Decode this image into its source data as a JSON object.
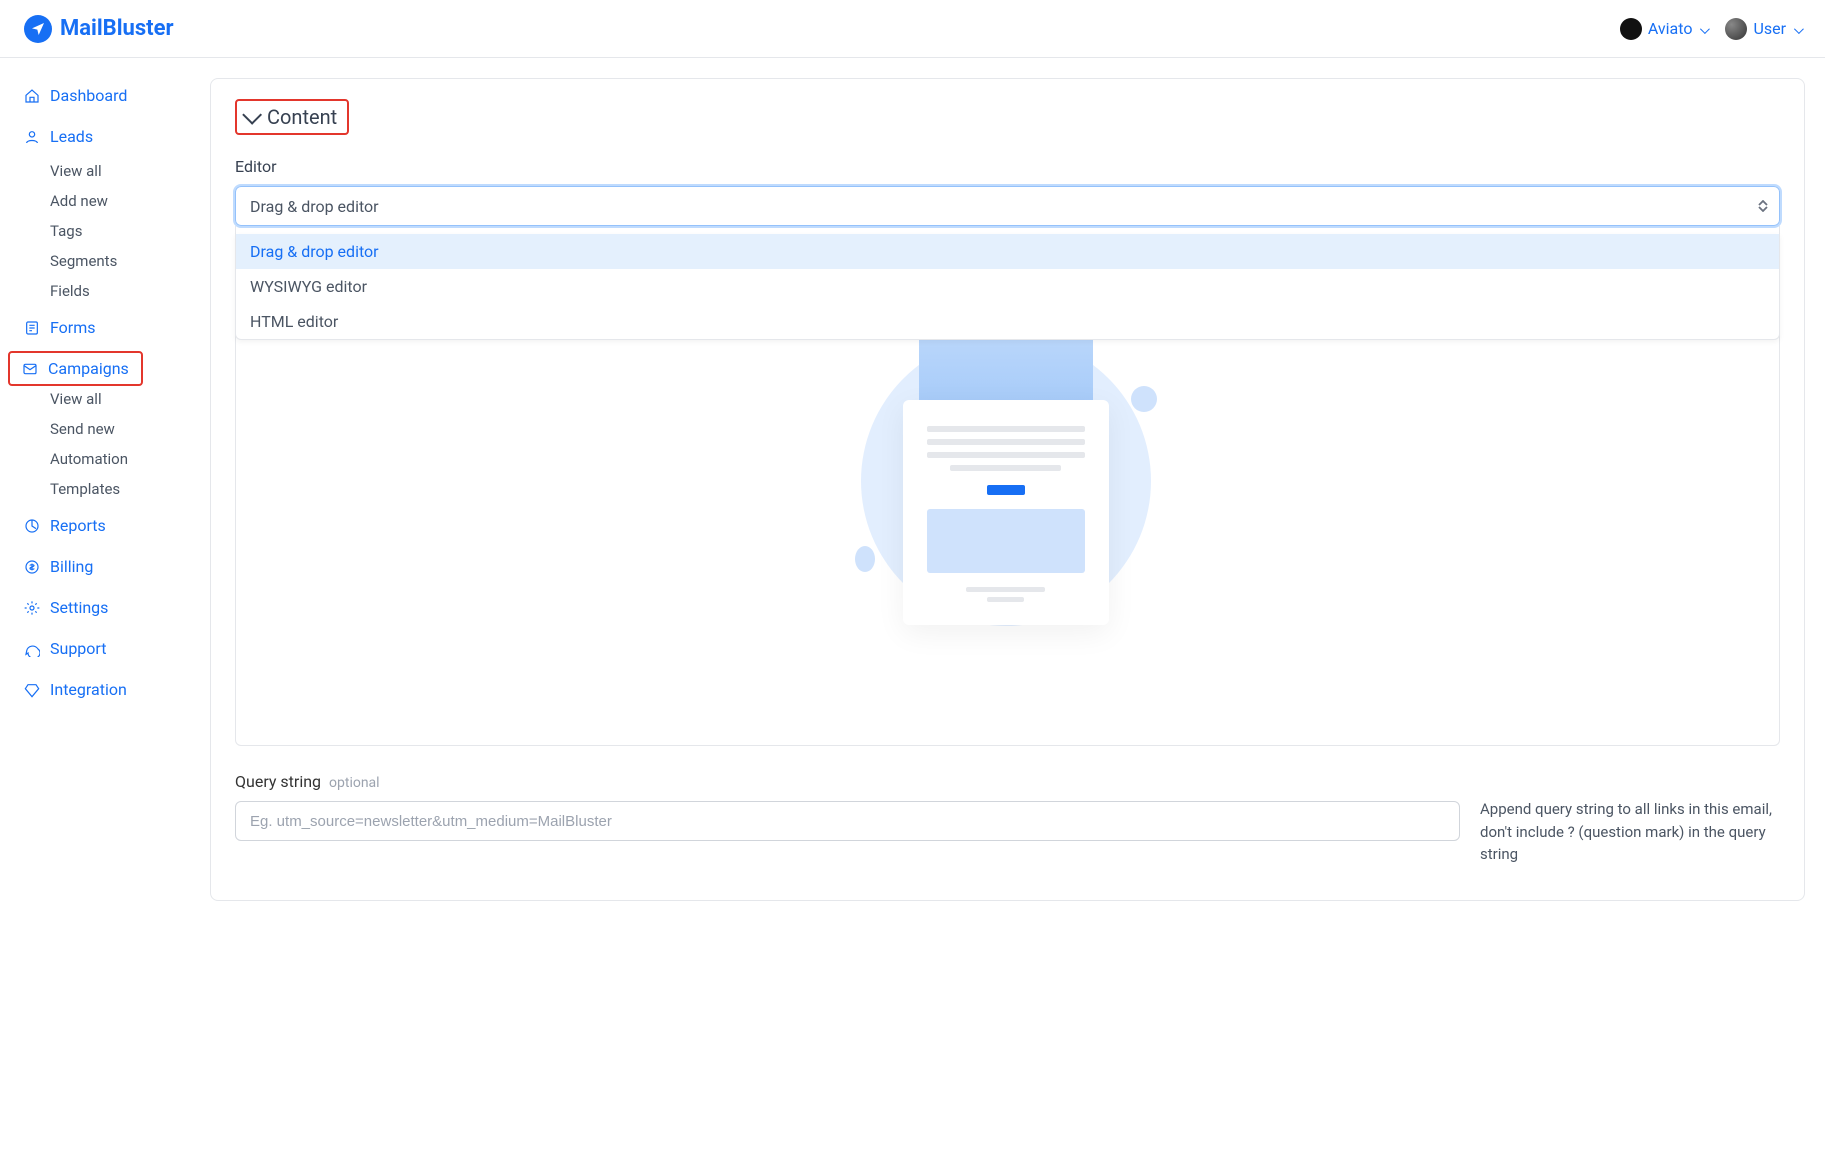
{
  "brand": {
    "name": "MailBluster"
  },
  "topbar": {
    "org_label": "Aviato",
    "user_label": "User"
  },
  "sidebar": {
    "dashboard": "Dashboard",
    "leads": {
      "label": "Leads",
      "items": [
        "View all",
        "Add new",
        "Tags",
        "Segments",
        "Fields"
      ]
    },
    "forms": "Forms",
    "campaigns": {
      "label": "Campaigns",
      "items": [
        "View all",
        "Send new",
        "Automation",
        "Templates"
      ]
    },
    "reports": "Reports",
    "billing": "Billing",
    "settings": "Settings",
    "support": "Support",
    "integration": "Integration"
  },
  "content": {
    "section_title": "Content",
    "editor_label": "Editor",
    "editor_value": "Drag & drop editor",
    "editor_options": [
      "Drag & drop editor",
      "WYSIWYG editor",
      "HTML editor"
    ],
    "query_string": {
      "label": "Query string",
      "optional": "optional",
      "placeholder": "Eg. utm_source=newsletter&utm_medium=MailBluster",
      "hint": "Append query string to all links in this email, don't include ? (question mark) in the query string"
    }
  },
  "highlights": [
    "content-section-header",
    "sidebar-campaigns"
  ]
}
